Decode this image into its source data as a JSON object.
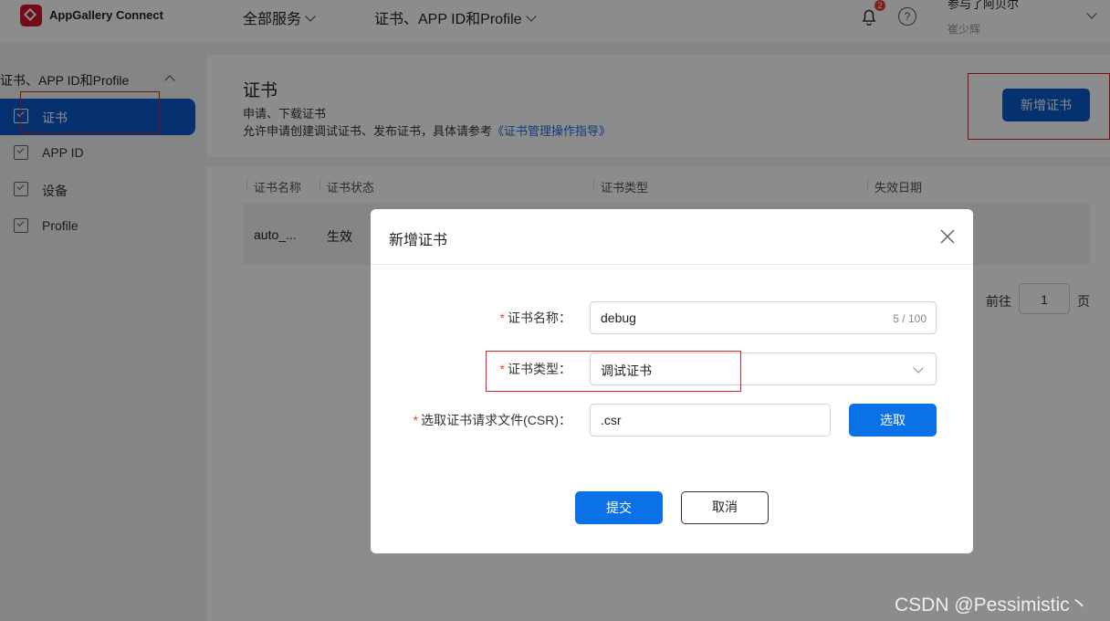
{
  "header": {
    "brand": "AppGallery Connect",
    "nav": [
      "全部服务",
      "证书、APP ID和Profile"
    ],
    "notification_count": "2",
    "help_symbol": "?",
    "user_name": "参与了阿贝尔",
    "user_sub": "崔少辉"
  },
  "sidebar": {
    "group_label": "证书、APP ID和Profile",
    "items": [
      {
        "label": "证书",
        "icon": "doc-check-icon",
        "active": true
      },
      {
        "label": "APP ID",
        "icon": "doc-check-icon",
        "active": false
      },
      {
        "label": "设备",
        "icon": "doc-check-icon",
        "active": false
      },
      {
        "label": "Profile",
        "icon": "doc-check-icon",
        "active": false
      }
    ]
  },
  "page": {
    "title": "证书",
    "subtitle": "申请、下载证书",
    "description_prefix": "允许申请创建调试证书、发布证书，具体请参考",
    "description_link": "《证书管理操作指导》",
    "add_button": "新增证书"
  },
  "table": {
    "headers": [
      "证书名称",
      "证书状态",
      "证书类型",
      "失效日期"
    ],
    "rows": [
      {
        "name": "auto_...",
        "status": "生效"
      }
    ],
    "pager": {
      "prefix": "前往",
      "page": "1",
      "suffix": "页"
    }
  },
  "modal": {
    "title": "新增证书",
    "fields": {
      "name": {
        "label": "证书名称：",
        "value": "debug",
        "counter": "5 / 100"
      },
      "type": {
        "label": "证书类型：",
        "value": "调试证书"
      },
      "csr": {
        "label": "选取证书请求文件(CSR)：",
        "value": ".csr",
        "button": "选取"
      }
    },
    "required_mark": "*",
    "submit": "提交",
    "cancel": "取消"
  },
  "watermark": "CSDN @Pessimistic丶",
  "colors": {
    "primary": "#0a59c8",
    "button_blue": "#0a71e6",
    "brand_red": "#d1172d",
    "highlight_red": "#e02020"
  }
}
